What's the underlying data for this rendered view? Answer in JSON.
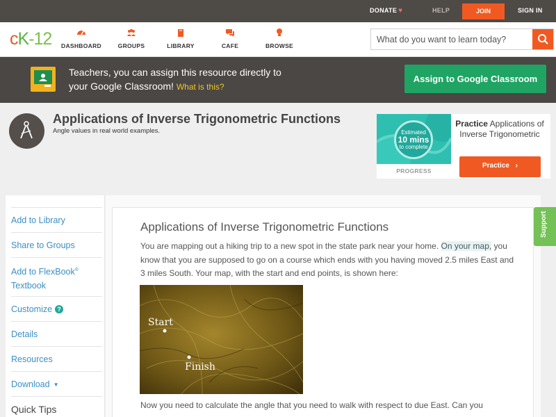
{
  "topbar": {
    "donate": "DONATE",
    "help": "HELP",
    "join": "JOIN",
    "signin": "SIGN IN"
  },
  "header": {
    "logo": {
      "c": "c",
      "k": "K",
      "n": "-12"
    },
    "nav": [
      {
        "label": "DASHBOARD",
        "icon": "dashboard-icon"
      },
      {
        "label": "GROUPS",
        "icon": "groups-icon"
      },
      {
        "label": "LIBRARY",
        "icon": "library-icon"
      },
      {
        "label": "CAFE",
        "icon": "cafe-icon"
      },
      {
        "label": "BROWSE",
        "icon": "browse-icon"
      }
    ],
    "search_placeholder": "What do you want to learn today?"
  },
  "banner": {
    "line1": "Teachers, you can assign this resource directly to",
    "line2": "your Google Classroom!",
    "whatis": "What is this?",
    "assign_button": "Assign to Google Classroom"
  },
  "concept": {
    "title": "Applications of Inverse Trigonometric Functions",
    "subtitle": "Angle values in real world examples."
  },
  "practice": {
    "estimated": "Estimated",
    "minutes": "10 mins",
    "to_complete": "to complete",
    "progress_label": "PROGRESS",
    "heading_bold": "Practice",
    "heading_rest": "Applications of Inverse Trigonometric",
    "button": "Practice"
  },
  "sidebar": {
    "items": [
      {
        "label": "Add to Library"
      },
      {
        "label": "Share to Groups"
      },
      {
        "label": "Add to FlexBook",
        "sup": "®",
        "label2": "Textbook"
      },
      {
        "label": "Customize"
      },
      {
        "label": "Details"
      },
      {
        "label": "Resources"
      },
      {
        "label": "Download"
      },
      {
        "label": "Quick Tips"
      }
    ]
  },
  "article": {
    "title": "Applications of Inverse Trigonometric Functions",
    "para1_a": "You are mapping out a hiking trip to a new spot in the state park near your home.",
    "para1_hl": "On your map,",
    "para1_b": "you know that you are supposed to go on a course which ends with you having moved 2.5 miles East and 3 miles South. Your map, with the start and end points, is shown here:",
    "map_start": "Start",
    "map_finish": "Finish",
    "para2": "Now you need to calculate the angle that you need to walk with respect to due East. Can you"
  },
  "support_tab": "Support",
  "colors": {
    "accent_orange": "#f05a22",
    "classroom_green": "#1fa463",
    "link_blue": "#3b8fc4",
    "teal": "#21a99a"
  }
}
